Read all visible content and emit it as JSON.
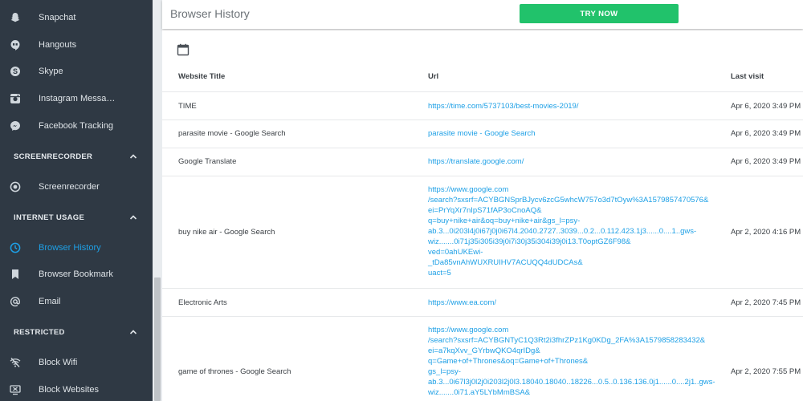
{
  "sidebar": {
    "items_top": [
      {
        "label": "Snapchat",
        "icon": "snapchat-icon"
      },
      {
        "label": "Hangouts",
        "icon": "hangouts-icon"
      },
      {
        "label": "Skype",
        "icon": "skype-icon"
      },
      {
        "label": "Instagram Messa…",
        "icon": "instagram-icon"
      },
      {
        "label": "Facebook Tracking",
        "icon": "messenger-icon"
      }
    ],
    "section_screenrecorder": "SCREENRECORDER",
    "screenrecorder_item": "Screenrecorder",
    "section_internet": "INTERNET USAGE",
    "internet_items": [
      {
        "label": "Browser History",
        "icon": "clock-icon"
      },
      {
        "label": "Browser Bookmark",
        "icon": "bookmark-icon"
      },
      {
        "label": "Email",
        "icon": "at-icon"
      }
    ],
    "section_restricted": "RESTRICTED",
    "restricted_items": [
      {
        "label": "Block Wifi",
        "icon": "wifi-off-icon"
      },
      {
        "label": "Block Websites",
        "icon": "block-websites-icon"
      }
    ],
    "active_color": "#1ea0e6"
  },
  "header": {
    "title": "Browser History",
    "try_button": "TRY NOW"
  },
  "table": {
    "columns": [
      "Website Title",
      "Url",
      "Last visit"
    ],
    "rows": [
      {
        "title": "TIME",
        "url": "https://time.com/5737103/best-movies-2019/",
        "last_visit": "Apr 6, 2020 3:49 PM"
      },
      {
        "title": "parasite movie - Google Search",
        "url": "parasite movie - Google Search",
        "last_visit": "Apr 6, 2020 3:49 PM"
      },
      {
        "title": "Google Translate",
        "url": "https://translate.google.com/",
        "last_visit": "Apr 6, 2020 3:49 PM"
      },
      {
        "title": "buy nike air - Google Search",
        "url_lines": [
          "https://www.google.com",
          "/search?sxsrf=ACYBGNSprBJycv6zcG5whcW757o3d7tOyw%3A1579857470576&",
          "ei=PrYqXr7nIpS71fAP3oCnoAQ&",
          "q=buy+nike+air&oq=buy+nike+air&gs_l=psy-",
          "ab.3...0i203l4j0i67j0j0i67l4.2040.2727..3039...0.2...0.112.423.1j3......0....1..gws-",
          "wiz.......0i71j35i305i39j0i7i30j35i304i39j0i13.T0optGZ6F98&",
          "ved=0ahUKEwi-",
          "_tDa85vnAhWUXRUIHV7ACUQQ4dUDCAs&",
          "uact=5"
        ],
        "last_visit": "Apr 2, 2020 4:16 PM"
      },
      {
        "title": "Electronic Arts",
        "url": "https://www.ea.com/",
        "last_visit": "Apr 2, 2020 7:45 PM"
      },
      {
        "title": "game of thrones - Google Search",
        "url_lines": [
          "https://www.google.com",
          "/search?sxsrf=ACYBGNTyC1Q3Rt2i3fhrZPz1Kg0KDg_2FA%3A1579858283432&",
          "ei=a7kqXvv_GYrbwQKO4qrIDg&",
          "q=Game+of+Thrones&oq=Game+of+Thrones&",
          "gs_l=psy-",
          "ab.3...0i67l3j0l2j0i203l2j0l3.18040.18040..18226...0.5..0.136.136.0j1......0....2j1..gws-",
          "wiz.......0i71.aY5LYbMmBSA&"
        ],
        "last_visit": "Apr 2, 2020 7:55 PM"
      }
    ]
  }
}
